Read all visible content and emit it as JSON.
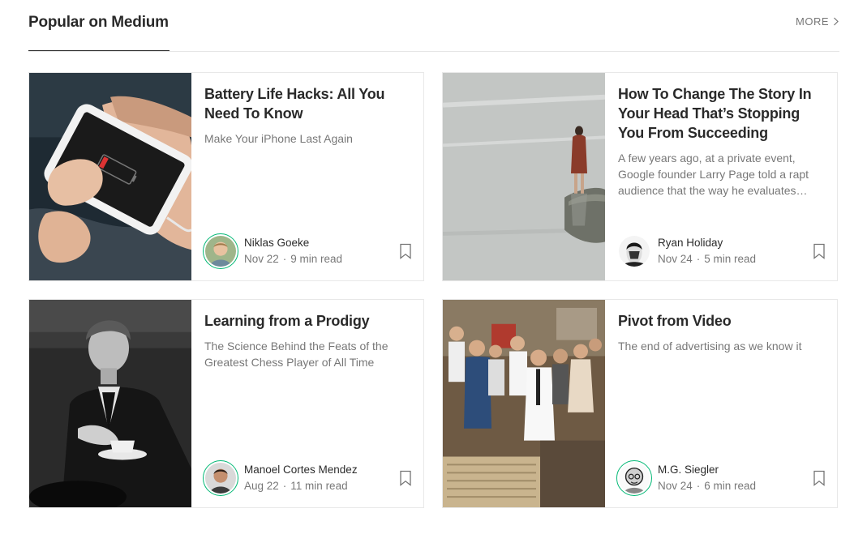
{
  "section": {
    "title": "Popular on Medium",
    "more_label": "MORE"
  },
  "accent_color": "#02b875",
  "cards": [
    {
      "title": "Battery Life Hacks: All You Need To Know",
      "subtitle": "Make Your iPhone Last Again",
      "author": "Niklas Goeke",
      "date": "Nov 22",
      "read_time": "9 min read",
      "image": "phone-low-battery-photo",
      "avatar_ring": true
    },
    {
      "title": "How To Change The Story In Your Head That’s Stopping You From Succeeding",
      "subtitle": "A few years ago, at a private event, Google founder Larry Page told a rapt audience that the way he evaluates…",
      "author": "Ryan Holiday",
      "date": "Nov 24",
      "read_time": "5 min read",
      "image": "woman-standing-by-lake-photo",
      "avatar_ring": false
    },
    {
      "title": "Learning from a Prodigy",
      "subtitle": "The Science Behind the Feats of the Greatest Chess Player of All Time",
      "author": "Manoel Cortes Mendez",
      "date": "Aug 22",
      "read_time": "11 min read",
      "image": "young-man-black-and-white-photo",
      "avatar_ring": true
    },
    {
      "title": "Pivot from Video",
      "subtitle": "The end of advertising as we know it",
      "author": "M.G. Siegler",
      "date": "Nov 24",
      "read_time": "6 min read",
      "image": "people-watching-tv-vintage-photo",
      "avatar_ring": true
    }
  ]
}
